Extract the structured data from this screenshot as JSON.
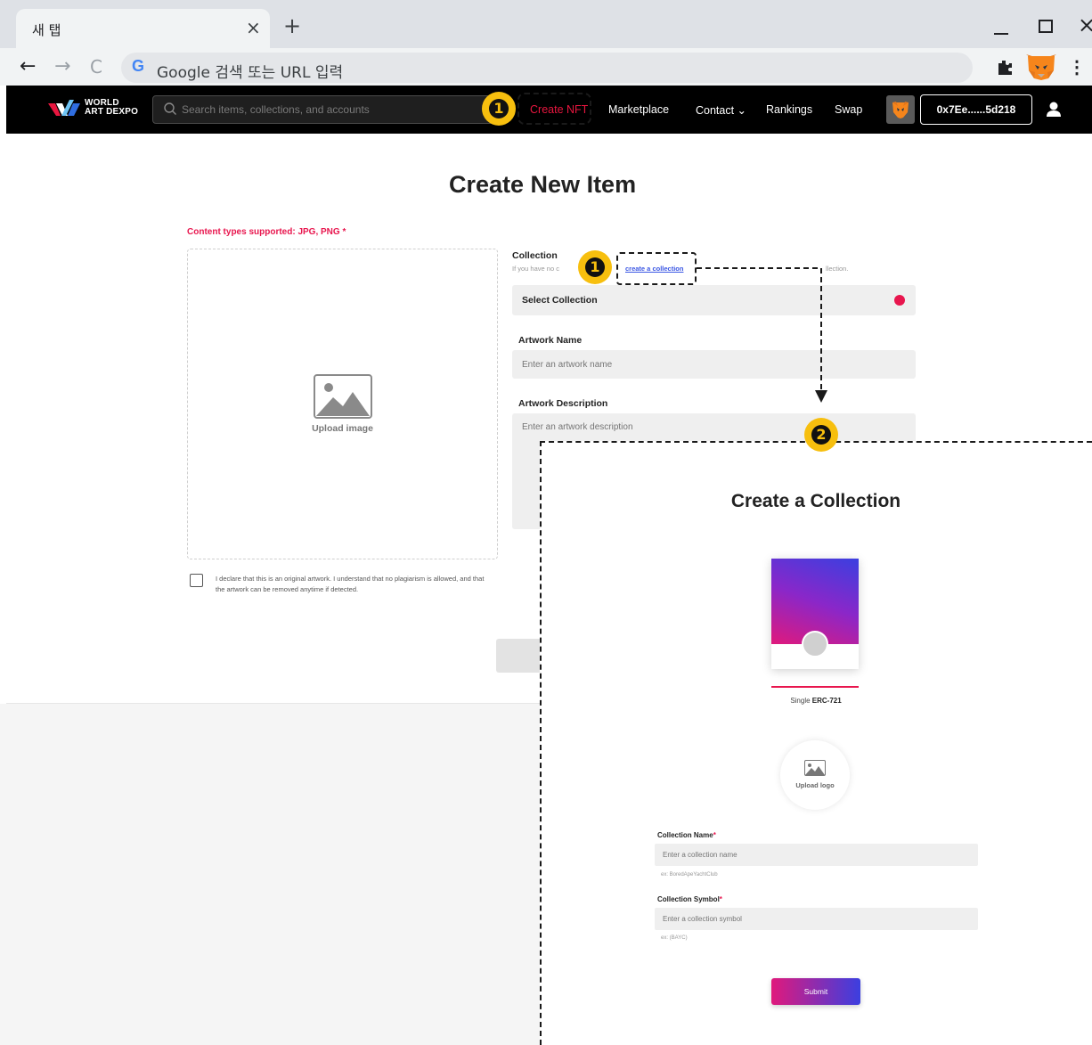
{
  "browser": {
    "tab_title": "새 탭",
    "tab_close": "×",
    "new_tab": "+",
    "omnibox_text": "Google 검색 또는 URL 입력",
    "g_logo": "G",
    "back": "←",
    "forward": "→",
    "reload": "C",
    "window_close": "×",
    "menu": "⋮",
    "icons": [
      "extensions-icon",
      "metamask-fox-icon"
    ]
  },
  "site_header": {
    "logo_line1": "WORLD",
    "logo_line2": "ART DEXPO",
    "search_placeholder": "Search items, collections, and accounts",
    "nav": {
      "create_nft": "Create NFT",
      "marketplace": "Marketplace",
      "contact": "Contact ⌄",
      "rankings": "Rankings",
      "swap": "Swap"
    },
    "wallet_address": "0x7Ee......5d218",
    "accent_color": "#e8163f"
  },
  "create_item": {
    "title": "Create New Item",
    "content_types": "Content types supported: JPG, PNG *",
    "upload_label": "Upload image",
    "declaration": "I declare that this is an original artwork. I understand that no plagiarism is allowed, and that the artwork can be removed anytime if detected.",
    "collection_label": "Collection",
    "collection_hint_start": "If you have no c",
    "create_collection_link": "create a collection",
    "collection_hint_end": "llection.",
    "select_collection": "Select Collection",
    "artwork_name_label": "Artwork Name",
    "artwork_name_placeholder": "Enter an artwork name",
    "artwork_desc_label": "Artwork Description",
    "artwork_desc_placeholder": "Enter an artwork description"
  },
  "annotations": {
    "step1": "1",
    "step2": "2",
    "badge_color": "#f7bf0e"
  },
  "create_collection_modal": {
    "title": "Create a Collection",
    "standard_prefix": "Single ",
    "standard_name": "ERC-721",
    "upload_logo": "Upload logo",
    "collection_name_label": "Collection Name",
    "collection_name_placeholder": "Enter a collection name",
    "collection_name_hint": "ex: BoredApeYachtClub",
    "collection_symbol_label": "Collection Symbol",
    "collection_symbol_placeholder": "Enter a collection symbol",
    "collection_symbol_hint": "ex: (BAYC)",
    "required_mark": "*",
    "submit": "Submit"
  }
}
